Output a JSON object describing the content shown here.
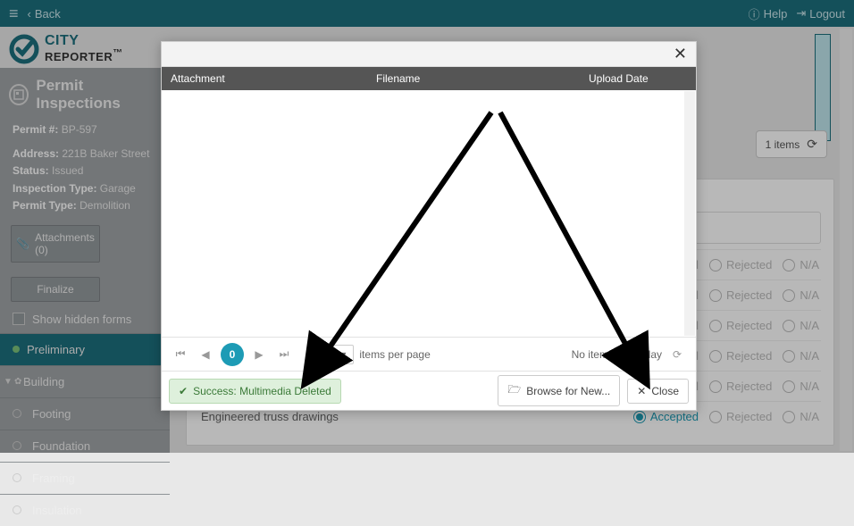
{
  "topbar": {
    "back": "Back",
    "help": "Help",
    "logout": "Logout"
  },
  "brand": {
    "city": "CITY",
    "reporter": "REPORTER",
    "tm": "™"
  },
  "section_title": "Permit Inspections",
  "details": {
    "permit_label": "Permit #:",
    "permit": "BP-597",
    "address_label": "Address:",
    "address": "221B Baker Street",
    "status_label": "Status:",
    "status": "Issued",
    "insp_type_label": "Inspection Type:",
    "insp_type": "Garage",
    "permit_type_label": "Permit Type:",
    "permit_type": "Demolition"
  },
  "buttons": {
    "attachments": "Attachments (0)",
    "finalize": "Finalize",
    "show_hidden": "Show hidden forms"
  },
  "nav": {
    "preliminary": "Preliminary",
    "building": "Building",
    "footing": "Footing",
    "foundation": "Foundation",
    "framing": "Framing",
    "insulation": "Insulation"
  },
  "right": {
    "items_count": "1 items"
  },
  "rows": {
    "r5": "Engineered truss drawings"
  },
  "opts": {
    "accepted": "Accepted",
    "rejected": "Rejected",
    "na": "N/A"
  },
  "modal": {
    "cols": {
      "attachment": "Attachment",
      "filename": "Filename",
      "upload": "Upload Date"
    },
    "pager": {
      "page": "0",
      "size": "10",
      "ipp": "items per page",
      "none": "No items to display"
    },
    "success": "Success: Multimedia Deleted",
    "browse": "Browse for New...",
    "close": "Close"
  }
}
